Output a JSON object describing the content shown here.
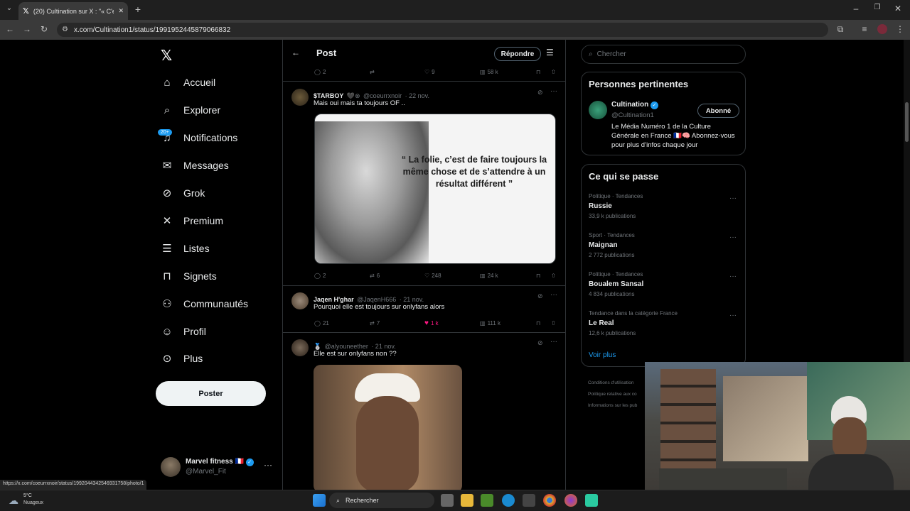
{
  "browser": {
    "tab_title": "(20) Cultination sur X : \"« C'est la",
    "url": "x.com/Cultination1/status/1991952445879066832",
    "status_url": "https://x.com/coeurrxnoir/status/1992044342546931758/photo/1"
  },
  "nav": {
    "items": [
      {
        "label": "Accueil",
        "icon": "home-icon"
      },
      {
        "label": "Explorer",
        "icon": "search-icon"
      },
      {
        "label": "Notifications",
        "icon": "bell-icon"
      },
      {
        "label": "Messages",
        "icon": "mail-icon"
      },
      {
        "label": "Grok",
        "icon": "grok-icon"
      },
      {
        "label": "Premium",
        "icon": "x-icon"
      },
      {
        "label": "Listes",
        "icon": "list-icon"
      },
      {
        "label": "Signets",
        "icon": "bookmark-icon"
      },
      {
        "label": "Communautés",
        "icon": "people-icon"
      },
      {
        "label": "Profil",
        "icon": "user-icon"
      },
      {
        "label": "Plus",
        "icon": "more-circle-icon"
      }
    ],
    "notif_badge": "20+",
    "post_button": "Poster",
    "account": {
      "name": "Marvel fitness",
      "flag": "🇫🇷",
      "handle": "@Marvel_Fit"
    }
  },
  "header": {
    "title": "Post",
    "reply_button": "Répondre"
  },
  "top_actions": {
    "replies": "2",
    "likes": "9",
    "views": "58 k"
  },
  "posts": [
    {
      "name": "$TARBOY",
      "handle": "@coeurrxnoir",
      "date": "· 22 nov.",
      "text": "Mais oui mais ta toujours OF ..",
      "image_quote": "“ La folie, c’est de faire toujours la même chose et de s’attendre à un résultat différent ”",
      "replies": "2",
      "reposts": "6",
      "likes": "248",
      "views": "24 k"
    },
    {
      "name": "Jaqen H'ghar",
      "handle": "@JaqenH666",
      "date": "· 21 nov.",
      "text": "Pourquoi elle est toujours sur onlyfans alors",
      "replies": "21",
      "reposts": "7",
      "likes": "1 k",
      "views": "111 k"
    },
    {
      "name": "",
      "handle": "@alyouneether",
      "date": "· 21 nov.",
      "text": "Elle est sur onlyfans non ??"
    }
  ],
  "right": {
    "search_placeholder": "Chercher",
    "relevant_title": "Personnes pertinentes",
    "relevant": {
      "name": "Cultination",
      "handle": "@Cultination1",
      "button": "Abonné",
      "bio": "Le Média Numéro 1 de la Culture Générale en France 🇫🇷🧠 Abonnez-vous pour plus d’infos chaque jour"
    },
    "trends_title": "Ce qui se passe",
    "trends": [
      {
        "category": "Politique · Tendances",
        "name": "Russie",
        "count": "33,9 k publications"
      },
      {
        "category": "Sport · Tendances",
        "name": "Maignan",
        "count": "2 772 publications"
      },
      {
        "category": "Politique · Tendances",
        "name": "Boualem Sansal",
        "count": "4 834 publications"
      },
      {
        "category": "Tendance dans la catégorie France",
        "name": "Le Real",
        "count": "12,6 k publications"
      }
    ],
    "show_more": "Voir plus",
    "footer": [
      "Conditions d'utilisation",
      "Politique relative aux co",
      "Informations sur les pub"
    ]
  },
  "taskbar": {
    "weather_temp": "5°C",
    "weather_desc": "Nuageux",
    "search": "Rechercher"
  },
  "colors": {
    "accent": "#1d9bf0",
    "like": "#f91880",
    "border": "#2f3336",
    "muted": "#71767b"
  }
}
